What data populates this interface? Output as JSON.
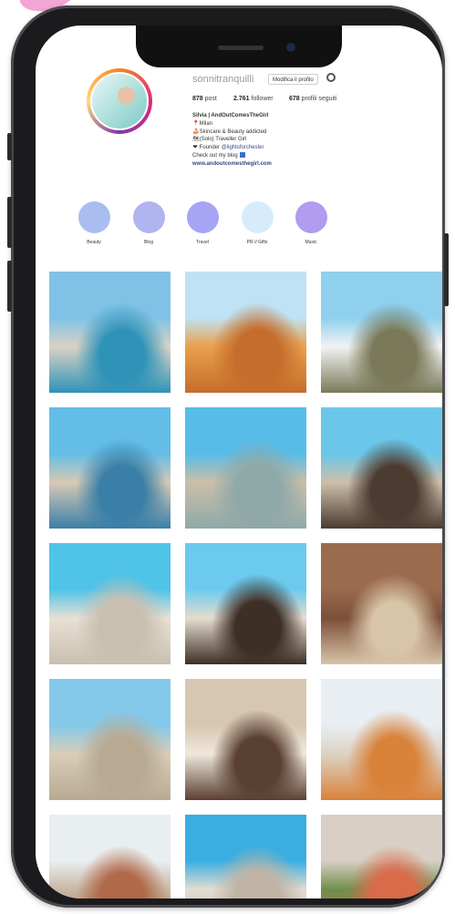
{
  "profile": {
    "username": "sonnitranquilli",
    "edit_button": "Modifica il profilo",
    "stats": [
      {
        "value": "878",
        "label": "post"
      },
      {
        "value": "2.761",
        "label": "follower"
      },
      {
        "value": "678",
        "label": "profili seguiti"
      }
    ],
    "bio": {
      "name": "Silvia | AndOutComesTheGirl",
      "lines": [
        {
          "icon": "pin-icon",
          "glyph": "📍",
          "text": "Milan"
        },
        {
          "icon": "cake-icon",
          "glyph": "🍰",
          "text": "Skincare & Beauty addicted"
        },
        {
          "icon": "map-icon",
          "glyph": "🗺",
          "text": "(Solo) Traveller Girl"
        },
        {
          "icon": "heart-icon",
          "glyph": "❤",
          "text": "Founder "
        }
      ],
      "mention": "@lightsforchester",
      "blog_text": "Check out my blog",
      "website": "www.andoutcomesthegirl.com"
    }
  },
  "highlights": [
    {
      "label": "Beauty",
      "color": "#a9bdf0"
    },
    {
      "label": "Blog",
      "color": "#b0b4ef"
    },
    {
      "label": "Travel",
      "color": "#a6a4f5"
    },
    {
      "label": "PR // Gifts",
      "color": "#d6ecfb"
    },
    {
      "label": "Music",
      "color": "#b19ced"
    }
  ],
  "posts": [
    {
      "name": "post-lisbon-blue-building",
      "colors": [
        "#7fc2e6",
        "#d9d2c4",
        "#2f93b8"
      ]
    },
    {
      "name": "post-pastel-de-nata",
      "colors": [
        "#bfe3f4",
        "#e9a04a",
        "#c56d2c"
      ]
    },
    {
      "name": "post-pasteis-de-belem-bag",
      "colors": [
        "#8ed0ee",
        "#f2f2f2",
        "#7a7a5a"
      ]
    },
    {
      "name": "post-lisbon-street-building",
      "colors": [
        "#63bde6",
        "#d8c9b4",
        "#3a7fa8"
      ]
    },
    {
      "name": "post-belem-tower",
      "colors": [
        "#57bde8",
        "#cbbfa8",
        "#8fa8a8"
      ]
    },
    {
      "name": "post-selfie-belem-tower",
      "colors": [
        "#6bc7ea",
        "#cdbfaa",
        "#4b3b30"
      ]
    },
    {
      "name": "post-discoveries-monument",
      "colors": [
        "#4fc3e8",
        "#e8e0d4",
        "#c9bfb0"
      ]
    },
    {
      "name": "post-selfie-jeronimos",
      "colors": [
        "#6ccaef",
        "#e6dccf",
        "#3d2f26"
      ]
    },
    {
      "name": "post-cloister-arches",
      "colors": [
        "#9b6b4e",
        "#7c4f3a",
        "#d8c4a8"
      ]
    },
    {
      "name": "post-jeronimos-monastery",
      "colors": [
        "#84c9ea",
        "#d9cdb9",
        "#b8aa92"
      ]
    },
    {
      "name": "post-girl-at-cloister",
      "colors": [
        "#d7c7b2",
        "#f0e8dc",
        "#5a4032"
      ]
    },
    {
      "name": "post-lisbon-tram-building",
      "colors": [
        "#e8eef2",
        "#dcd2c4",
        "#d9823a"
      ]
    },
    {
      "name": "post-lisbon-elevator",
      "colors": [
        "#e9eef0",
        "#c9b7a3",
        "#b06a4a"
      ]
    },
    {
      "name": "post-statue-sky",
      "colors": [
        "#3aaee0",
        "#e4ddd2",
        "#bfb4a5"
      ]
    },
    {
      "name": "post-salad-plate",
      "colors": [
        "#d9cfc4",
        "#6f8f4b",
        "#d96a4a"
      ]
    }
  ]
}
